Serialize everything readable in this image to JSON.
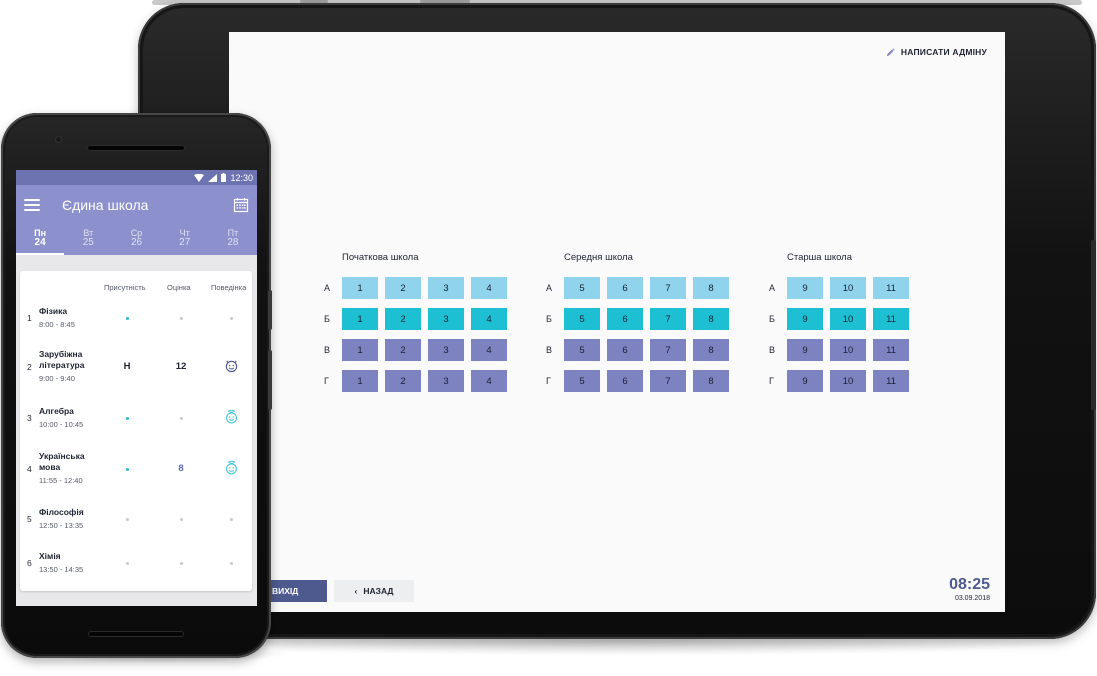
{
  "tablet": {
    "admin_link": "НАПИСАТИ АДМІНУ",
    "groups": [
      {
        "title": "Початкова школа",
        "rows": [
          {
            "letter": "А",
            "color": "#8fd3ec",
            "classes": [
              "1",
              "2",
              "3",
              "4"
            ]
          },
          {
            "letter": "Б",
            "color": "#1dbfd3",
            "classes": [
              "1",
              "2",
              "3",
              "4"
            ]
          },
          {
            "letter": "В",
            "color": "#7d82c0",
            "classes": [
              "1",
              "2",
              "3",
              "4"
            ]
          },
          {
            "letter": "Г",
            "color": "#7d82c0",
            "classes": [
              "1",
              "2",
              "3",
              "4"
            ]
          }
        ]
      },
      {
        "title": "Середня школа",
        "rows": [
          {
            "letter": "А",
            "color": "#8fd3ec",
            "classes": [
              "5",
              "6",
              "7",
              "8"
            ]
          },
          {
            "letter": "Б",
            "color": "#1dbfd3",
            "classes": [
              "5",
              "6",
              "7",
              "8"
            ]
          },
          {
            "letter": "В",
            "color": "#7d82c0",
            "classes": [
              "5",
              "6",
              "7",
              "8"
            ]
          },
          {
            "letter": "Г",
            "color": "#7d82c0",
            "classes": [
              "5",
              "6",
              "7",
              "8"
            ]
          }
        ]
      },
      {
        "title": "Старша школа",
        "rows": [
          {
            "letter": "А",
            "color": "#8fd3ec",
            "classes": [
              "9",
              "10",
              "11"
            ]
          },
          {
            "letter": "Б",
            "color": "#1dbfd3",
            "classes": [
              "9",
              "10",
              "11"
            ]
          },
          {
            "letter": "В",
            "color": "#7d82c0",
            "classes": [
              "9",
              "10",
              "11"
            ]
          },
          {
            "letter": "Г",
            "color": "#7d82c0",
            "classes": [
              "9",
              "10",
              "11"
            ]
          }
        ]
      }
    ],
    "exit_label": "ВИХІД",
    "back_label": "НАЗАД",
    "clock_time": "08:25",
    "clock_date": "03.09.2018"
  },
  "phone": {
    "status_time": "12:30",
    "app_title": "Єдина школа",
    "days": [
      {
        "name": "Пн",
        "num": "24",
        "active": true
      },
      {
        "name": "Вт",
        "num": "25",
        "active": false
      },
      {
        "name": "Ср",
        "num": "26",
        "active": false
      },
      {
        "name": "Чт",
        "num": "27",
        "active": false
      },
      {
        "name": "Пт",
        "num": "28",
        "active": false
      }
    ],
    "columns": {
      "attendance": "Присутність",
      "grade": "Оцінка",
      "behavior": "Поведінка"
    },
    "lessons": [
      {
        "num": "1",
        "name": "Фізика",
        "time": "8:00 - 8:45",
        "attendance": "dot-teal",
        "grade": "",
        "grade_style": "",
        "behavior": "dot"
      },
      {
        "num": "2",
        "name": "Зарубіжна література",
        "time": "9:00 - 9:40",
        "attendance": "Н",
        "grade": "12",
        "grade_style": "dark",
        "behavior": "devil-icon"
      },
      {
        "num": "3",
        "name": "Алгебра",
        "time": "10:00 - 10:45",
        "attendance": "dot-teal",
        "grade": "",
        "grade_style": "",
        "behavior": "angel-icon"
      },
      {
        "num": "4",
        "name": "Українська мова",
        "time": "11:55 - 12:40",
        "attendance": "dot-teal",
        "grade": "8",
        "grade_style": "purple",
        "behavior": "angel-icon"
      },
      {
        "num": "5",
        "name": "Філософія",
        "time": "12:50 - 13:35",
        "attendance": "dot",
        "grade": "",
        "grade_style": "",
        "behavior": "dot"
      },
      {
        "num": "6",
        "name": "Хімія",
        "time": "13:50 - 14:35",
        "attendance": "dot",
        "grade": "",
        "grade_style": "",
        "behavior": "dot"
      }
    ]
  }
}
